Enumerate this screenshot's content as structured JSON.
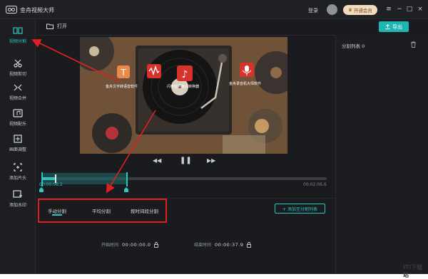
{
  "app": {
    "title": "金舟视频大师",
    "login": "登录",
    "vip": "开通会员"
  },
  "toolbar": {
    "open": "打开",
    "export": "导出"
  },
  "sidebar": {
    "items": [
      {
        "label": "视频分割",
        "icon": "split-icon",
        "active": true
      },
      {
        "label": "视频剪切",
        "icon": "scissors-icon"
      },
      {
        "label": "视频合并",
        "icon": "merge-icon"
      },
      {
        "label": "视频配乐",
        "icon": "music-icon"
      },
      {
        "label": "画面调整",
        "icon": "crop-icon"
      },
      {
        "label": "添加片头",
        "icon": "add-intro-icon"
      },
      {
        "label": "添加水印",
        "icon": "watermark-icon"
      }
    ]
  },
  "preview": {
    "captions": [
      "金舟文字转语音软件",
      "闪电音频格式转换器",
      "金舟录音机大师软件"
    ]
  },
  "playback": {
    "current_time": "00:00:06.2",
    "total_time": "00:02:06.6",
    "progress": 0.05,
    "selection_end": 0.3
  },
  "tabs": {
    "manual": "手动分割",
    "average": "平均分割",
    "by_time": "按时间段分割",
    "add_to_list": "+ 添加至分割列表"
  },
  "times": {
    "start_label": "开始时间",
    "start_value": "00:00:00.0",
    "end_label": "结束时间",
    "end_value": "00:00:37.9"
  },
  "right_panel": {
    "title": "分割列表 0"
  },
  "watermark": "ITi下载站",
  "colors": {
    "accent": "#2fc6c0",
    "annotation": "#e02020",
    "vip": "#f2dcc0"
  }
}
